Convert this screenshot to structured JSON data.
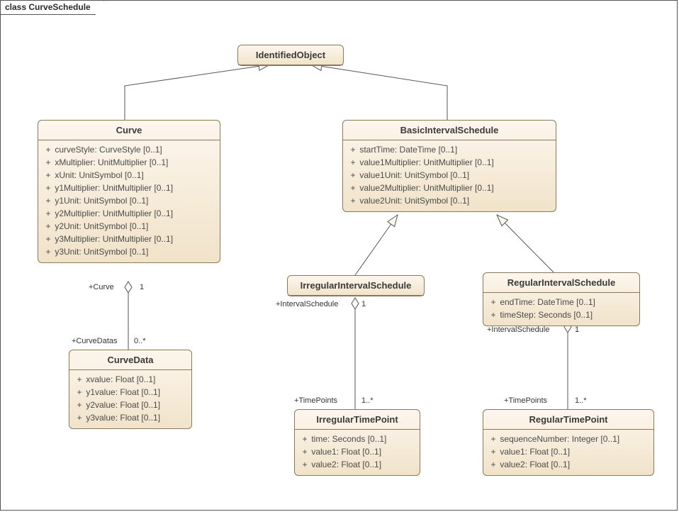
{
  "frame": {
    "title": "class CurveSchedule"
  },
  "classes": {
    "identifiedObject": {
      "name": "IdentifiedObject",
      "attrs": []
    },
    "curve": {
      "name": "Curve",
      "attrs": [
        "curveStyle: CurveStyle [0..1]",
        "xMultiplier: UnitMultiplier [0..1]",
        "xUnit: UnitSymbol [0..1]",
        "y1Multiplier: UnitMultiplier [0..1]",
        "y1Unit: UnitSymbol [0..1]",
        "y2Multiplier: UnitMultiplier [0..1]",
        "y2Unit: UnitSymbol [0..1]",
        "y3Multiplier: UnitMultiplier [0..1]",
        "y3Unit: UnitSymbol [0..1]"
      ]
    },
    "basicIntervalSchedule": {
      "name": "BasicIntervalSchedule",
      "attrs": [
        "startTime: DateTime [0..1]",
        "value1Multiplier: UnitMultiplier [0..1]",
        "value1Unit: UnitSymbol [0..1]",
        "value2Multiplier: UnitMultiplier [0..1]",
        "value2Unit: UnitSymbol [0..1]"
      ]
    },
    "curveData": {
      "name": "CurveData",
      "attrs": [
        "xvalue: Float [0..1]",
        "y1value: Float [0..1]",
        "y2value: Float [0..1]",
        "y3value: Float [0..1]"
      ]
    },
    "irregularIntervalSchedule": {
      "name": "IrregularIntervalSchedule",
      "attrs": []
    },
    "regularIntervalSchedule": {
      "name": "RegularIntervalSchedule",
      "attrs": [
        "endTime: DateTime [0..1]",
        "timeStep: Seconds [0..1]"
      ]
    },
    "irregularTimePoint": {
      "name": "IrregularTimePoint",
      "attrs": [
        "time: Seconds [0..1]",
        "value1: Float [0..1]",
        "value2: Float [0..1]"
      ]
    },
    "regularTimePoint": {
      "name": "RegularTimePoint",
      "attrs": [
        "sequenceNumber: Integer [0..1]",
        "value1: Float [0..1]",
        "value2: Float [0..1]"
      ]
    }
  },
  "roles": {
    "curveEnd": {
      "name": "+Curve",
      "mult": "1"
    },
    "curveDataEnd": {
      "name": "+CurveDatas",
      "mult": "0..*"
    },
    "irSchedEnd": {
      "name": "+IntervalSchedule",
      "mult": "1"
    },
    "irTPEnd": {
      "name": "+TimePoints",
      "mult": "1..*"
    },
    "regSchedEnd": {
      "name": "+IntervalSchedule",
      "mult": "1"
    },
    "regTPEnd": {
      "name": "+TimePoints",
      "mult": "1..*"
    }
  }
}
